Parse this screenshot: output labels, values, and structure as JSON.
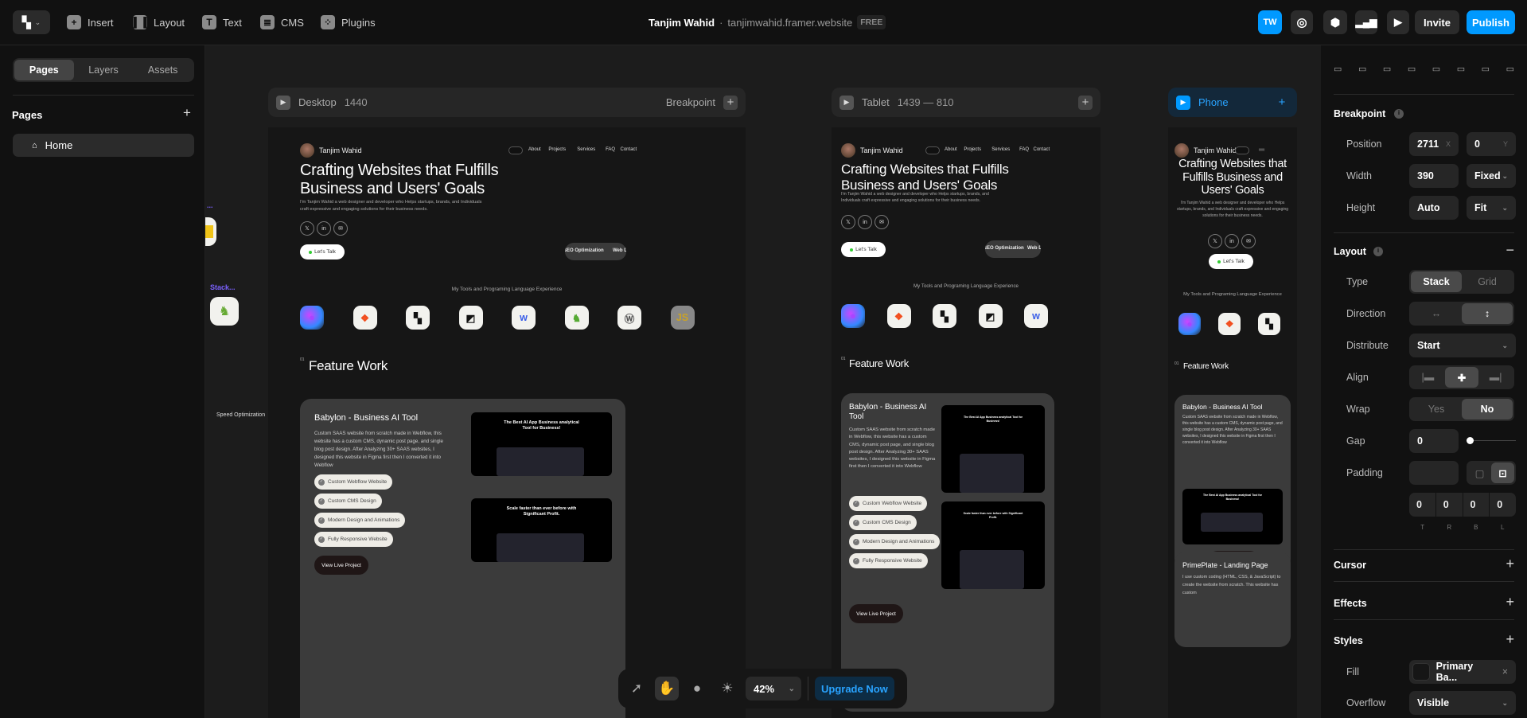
{
  "topbar": {
    "menu": [
      {
        "label": "Insert",
        "icon": "plus-square-icon"
      },
      {
        "label": "Layout",
        "icon": "layout-icon"
      },
      {
        "label": "Text",
        "icon": "text-icon"
      },
      {
        "label": "CMS",
        "icon": "database-icon"
      },
      {
        "label": "Plugins",
        "icon": "plugins-icon"
      }
    ],
    "project_name": "Tanjim Wahid",
    "separator": "·",
    "domain": "tanjimwahid.framer.website",
    "plan_badge": "FREE",
    "avatar_initials": "TW",
    "invite": "Invite",
    "publish": "Publish",
    "accent": "#0099ff"
  },
  "sidebar": {
    "tabs": [
      "Pages",
      "Layers",
      "Assets"
    ],
    "active_tab": "Pages",
    "section_title": "Pages",
    "pages": [
      {
        "label": "Home",
        "icon": "home-icon"
      }
    ]
  },
  "canvas": {
    "frames": [
      {
        "label": "Desktop",
        "size": "1440",
        "action": "Breakpoint"
      },
      {
        "label": "Tablet",
        "size": "1439 — 810"
      },
      {
        "label": "Phone",
        "size": ""
      }
    ],
    "offscreen": {
      "label_1": "...",
      "label_2": "Stack...",
      "label_3": "Speed Optimization"
    }
  },
  "site": {
    "name": "Tanjim Wahid",
    "nav": [
      "About",
      "Projects",
      "Services",
      "FAQ",
      "Contact"
    ],
    "heading": "Crafting Websites that Fulfills Business and Users' Goals",
    "intro": "I'm Tanjim Wahid a web designer and developer who Helps startups, brands, and Individuals craft expressive and engaging solutions for their business needs.",
    "socials": [
      "x-icon",
      "linkedin-icon",
      "email-icon"
    ],
    "cta": "Let's Talk",
    "marquee": [
      "SEO Optimization",
      "Web D"
    ],
    "tools_title": "My Tools and Programing Language Experience",
    "tools": [
      "spline-icon",
      "figma-icon",
      "framer-icon",
      "overflow-icon",
      "webflow-icon",
      "stack-mascot-icon",
      "wordpress-icon",
      "javascript-icon"
    ],
    "feature_num": "01",
    "feature_title": "Feature Work",
    "projects": [
      {
        "title": "Babylon - Business AI Tool",
        "desc": "Custom SAAS website from scratch made in Webflow, this website has a custom CMS, dynamic post page, and single blog post design. After Analyzing 30+ SAAS websites, I designed this website in Figma first then I converted it into Webflow",
        "chips": [
          "Custom Webflow Website",
          "Custom CMS Design",
          "Modern Design and Animations",
          "Fully Responsive Website"
        ],
        "button": "View Live Project",
        "shot_1": "The Best AI App Business analytical Tool for Business!",
        "shot_2": "Scale faster than ever before with Significant Profit."
      },
      {
        "title": "PrimePlate - Landing Page",
        "desc": "I use custom coding (HTML, CSS, & JavaScript) to create the website from scratch. This website has custom"
      }
    ]
  },
  "toolbar": {
    "zoom": "42%",
    "upgrade": "Upgrade Now"
  },
  "properties": {
    "breakpoint": {
      "title": "Breakpoint",
      "position_label": "Position",
      "x": "2711",
      "x_unit": "X",
      "y": "0",
      "y_unit": "Y",
      "width_label": "Width",
      "width": "390",
      "width_mode": "Fixed",
      "height_label": "Height",
      "height": "Auto",
      "height_mode": "Fit"
    },
    "layout": {
      "title": "Layout",
      "type_label": "Type",
      "type_options": [
        "Stack",
        "Grid"
      ],
      "type": "Stack",
      "direction_label": "Direction",
      "direction": "vertical",
      "distribute_label": "Distribute",
      "distribute": "Start",
      "align_label": "Align",
      "align": "center",
      "wrap_label": "Wrap",
      "wrap_options": [
        "Yes",
        "No"
      ],
      "wrap": "No",
      "gap_label": "Gap",
      "gap": "0",
      "padding_label": "Padding",
      "padding": [
        "0",
        "0",
        "0",
        "0"
      ],
      "padding_sides": [
        "T",
        "R",
        "B",
        "L"
      ]
    },
    "cursor": "Cursor",
    "effects": "Effects",
    "styles": {
      "title": "Styles",
      "fill_label": "Fill",
      "fill": "Primary Ba...",
      "overflow_label": "Overflow",
      "overflow": "Visible"
    }
  }
}
